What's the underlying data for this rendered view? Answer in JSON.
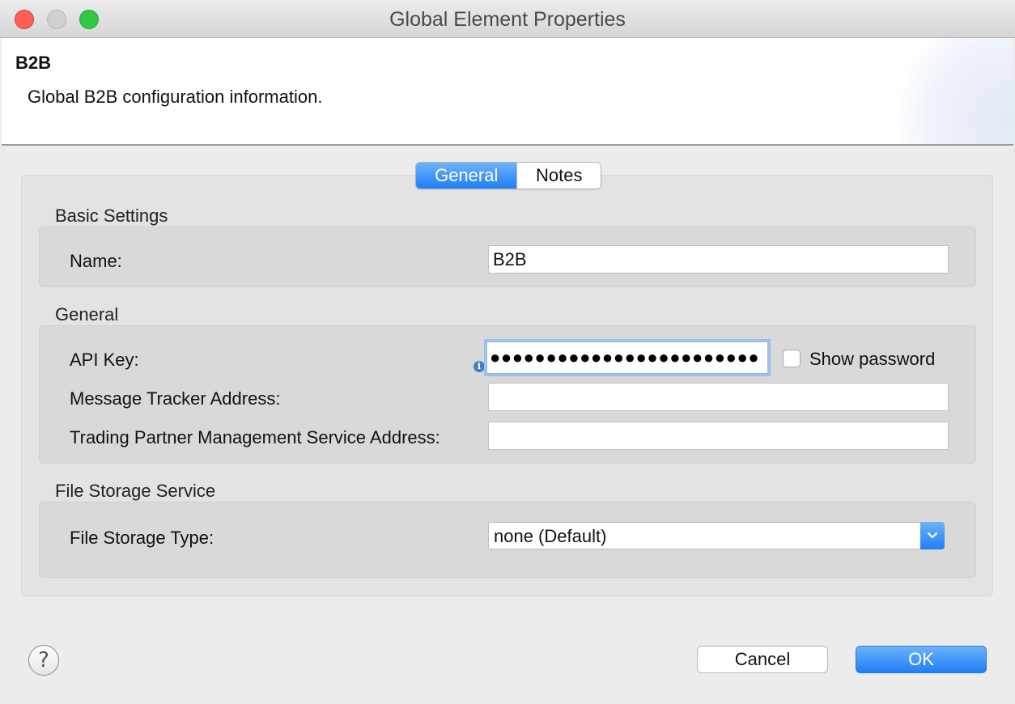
{
  "window": {
    "title": "Global Element Properties"
  },
  "header": {
    "title": "B2B",
    "description": "Global B2B configuration information."
  },
  "tabs": [
    {
      "label": "General",
      "selected": true
    },
    {
      "label": "Notes",
      "selected": false
    }
  ],
  "sections": {
    "basic": {
      "title": "Basic Settings",
      "name_label": "Name:",
      "name_value": "B2B"
    },
    "general": {
      "title": "General",
      "api_key_label": "API Key:",
      "api_key_masked": "●●●●●●●●●●●●●●●●●●●●●●●●",
      "show_password_label": "Show password",
      "show_password_checked": false,
      "tracker_label": "Message Tracker Address:",
      "tracker_value": "",
      "tpm_label": "Trading Partner Management Service Address:",
      "tpm_value": ""
    },
    "file_storage": {
      "title": "File Storage Service",
      "type_label": "File Storage Type:",
      "type_value": "none (Default)"
    }
  },
  "footer": {
    "help_icon": "?",
    "cancel_label": "Cancel",
    "ok_label": "OK"
  },
  "colors": {
    "accent_blue": "#1f7ef5",
    "close_red": "#fc5f57",
    "maximize_green": "#33c748"
  }
}
